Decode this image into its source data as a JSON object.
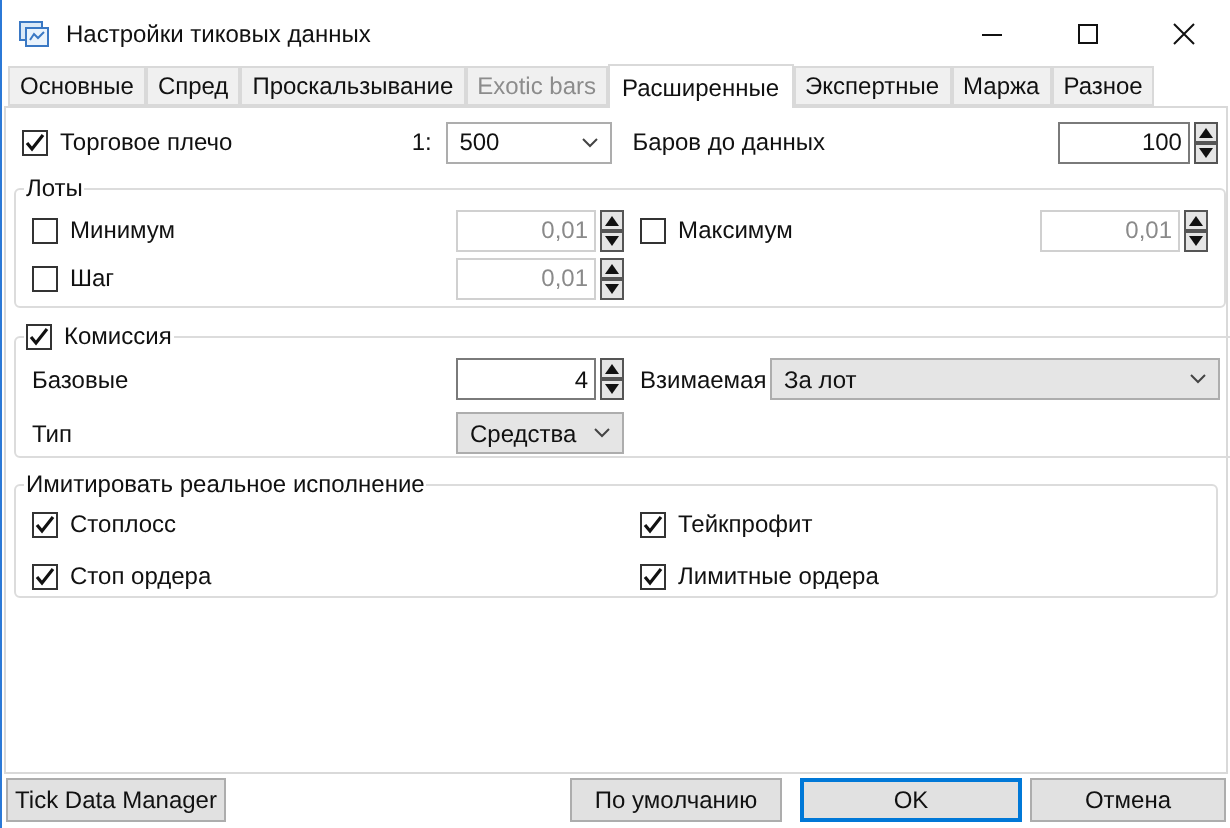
{
  "window": {
    "title": "Настройки тиковых данных"
  },
  "tabs": [
    {
      "label": "Основные",
      "selected": false,
      "disabled": false
    },
    {
      "label": "Спред",
      "selected": false,
      "disabled": false
    },
    {
      "label": "Проскальзывание",
      "selected": false,
      "disabled": false
    },
    {
      "label": "Exotic bars",
      "selected": false,
      "disabled": true
    },
    {
      "label": "Расширенные",
      "selected": true,
      "disabled": false
    },
    {
      "label": "Экспертные",
      "selected": false,
      "disabled": false
    },
    {
      "label": "Маржа",
      "selected": false,
      "disabled": false
    },
    {
      "label": "Разное",
      "selected": false,
      "disabled": false
    }
  ],
  "leverage": {
    "label": "Торговое плечо",
    "checked": true,
    "prefix": "1:",
    "value": "500"
  },
  "bars_to_data": {
    "label": "Баров до данных",
    "value": "100"
  },
  "lots": {
    "title": "Лоты",
    "items": [
      {
        "label": "Минимум",
        "checked": false,
        "value": "0,01",
        "disabled": true
      },
      {
        "label": "Максимум",
        "checked": false,
        "value": "0,01",
        "disabled": true
      },
      {
        "label": "Шаг",
        "checked": false,
        "value": "0,01",
        "disabled": true
      }
    ]
  },
  "commission": {
    "label": "Комиссия",
    "checked": true,
    "base_label": "Базовые",
    "base_value": "4",
    "charged_label": "Взимаемая",
    "charged_value": "За лот",
    "type_label": "Тип",
    "type_value": "Средства"
  },
  "simulate": {
    "title": "Имитировать реальное исполнение",
    "options": [
      {
        "label": "Стоплосс",
        "checked": true
      },
      {
        "label": "Тейкпрофит",
        "checked": true
      },
      {
        "label": "Стоп ордера",
        "checked": true
      },
      {
        "label": "Лимитные ордера",
        "checked": true
      }
    ]
  },
  "buttons": [
    {
      "label": "Tick Data Manager",
      "default": false
    },
    {
      "label": "По умолчанию",
      "default": false
    },
    {
      "label": "OK",
      "default": true
    },
    {
      "label": "Отмена",
      "default": false
    }
  ]
}
